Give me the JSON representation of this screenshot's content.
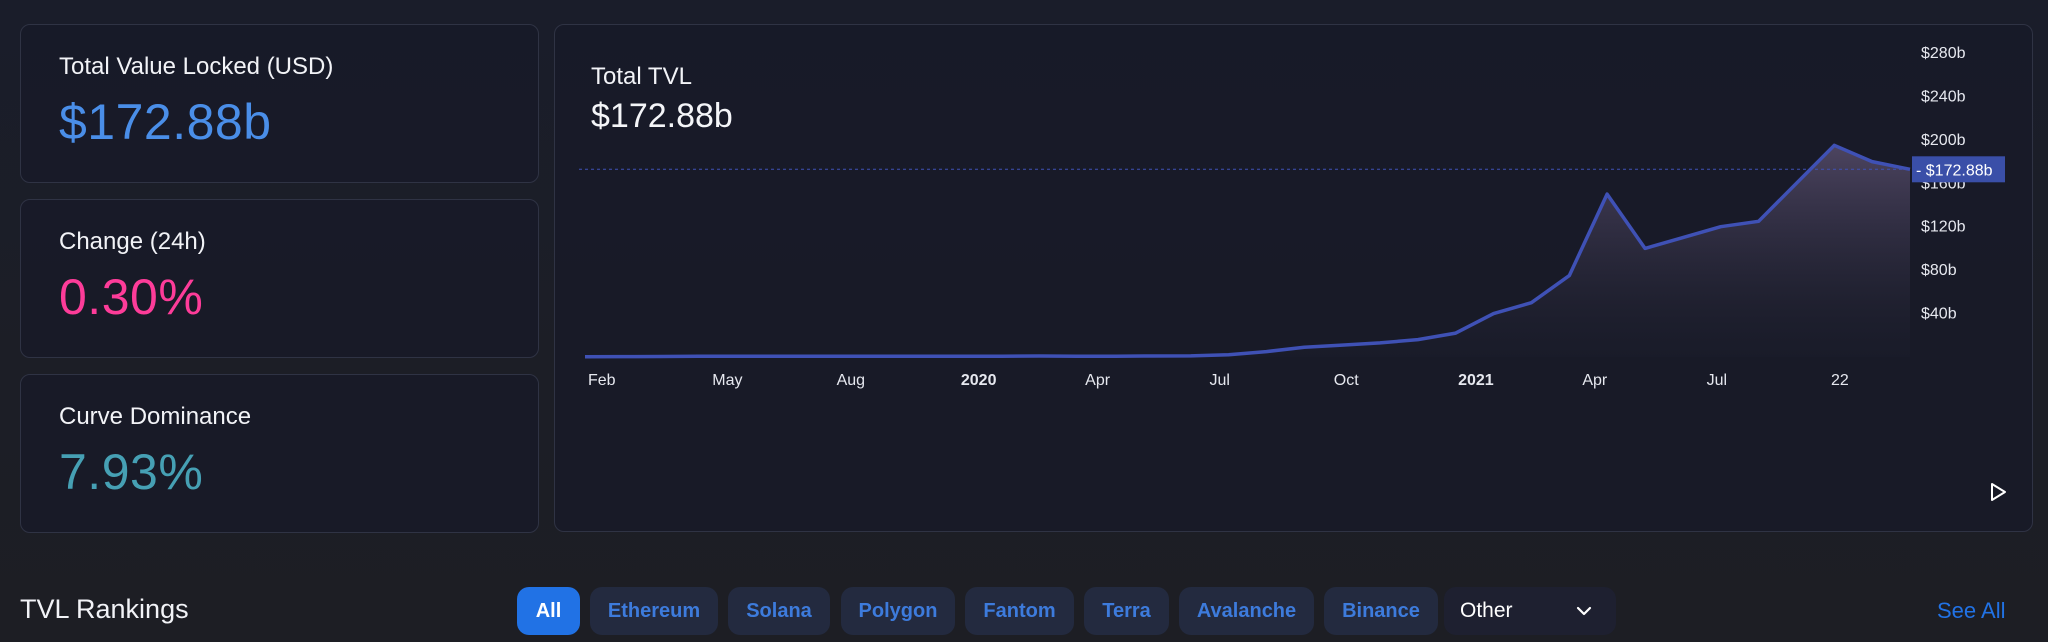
{
  "stats": [
    {
      "label": "Total Value Locked (USD)",
      "value": "$172.88b",
      "color": "#4a8ee8"
    },
    {
      "label": "Change (24h)",
      "value": "0.30%",
      "color": "#fd3c99"
    },
    {
      "label": "Curve Dominance",
      "value": "7.93%",
      "color": "#46a0b4"
    }
  ],
  "chart": {
    "title": "Total TVL",
    "value": "$172.88b",
    "current_label": "$172.88b"
  },
  "chart_data": {
    "type": "area",
    "title": "Total TVL",
    "xlabel": "",
    "ylabel": "",
    "ylim": [
      0,
      280
    ],
    "y_unit": "USD billions",
    "y_ticks": [
      "$40b",
      "$80b",
      "$120b",
      "$160b",
      "$200b",
      "$240b",
      "$280b"
    ],
    "x_ticks": [
      {
        "label": "Feb",
        "bold": false
      },
      {
        "label": "May",
        "bold": false
      },
      {
        "label": "Aug",
        "bold": false
      },
      {
        "label": "2020",
        "bold": true
      },
      {
        "label": "Apr",
        "bold": false
      },
      {
        "label": "Jul",
        "bold": false
      },
      {
        "label": "Oct",
        "bold": false
      },
      {
        "label": "2021",
        "bold": true
      },
      {
        "label": "Apr",
        "bold": false
      },
      {
        "label": "Jul",
        "bold": false
      },
      {
        "label": "22",
        "bold": false
      }
    ],
    "x": [
      "2019-02",
      "2019-03",
      "2019-04",
      "2019-05",
      "2019-06",
      "2019-07",
      "2019-08",
      "2019-09",
      "2019-10",
      "2019-11",
      "2019-12",
      "2020-01",
      "2020-02",
      "2020-03",
      "2020-04",
      "2020-05",
      "2020-06",
      "2020-07",
      "2020-08",
      "2020-09",
      "2020-10",
      "2020-11",
      "2020-12",
      "2021-01",
      "2021-02",
      "2021-03",
      "2021-04",
      "2021-05",
      "2021-06",
      "2021-07",
      "2021-08",
      "2021-09",
      "2021-10",
      "2021-11",
      "2021-12",
      "2022-01"
    ],
    "series": [
      {
        "values": [
          0.3,
          0.4,
          0.5,
          0.6,
          0.6,
          0.6,
          0.6,
          0.6,
          0.6,
          0.7,
          0.7,
          0.7,
          0.9,
          0.6,
          0.7,
          0.9,
          1.0,
          2.0,
          5.0,
          9.0,
          11.0,
          13.0,
          16.0,
          22.0,
          40.0,
          50.0,
          75.0,
          150.0,
          100.0,
          110.0,
          120.0,
          125.0,
          160.0,
          195.0,
          180.0,
          172.88
        ]
      }
    ],
    "current_value": 172.88,
    "colors": {
      "line": "#3f51b5",
      "fill_top": "#5a4f6e",
      "fill_bottom": "#1e2030",
      "marker_bg": "#3a4fa8"
    },
    "grid": false
  },
  "rankings": {
    "title": "TVL Rankings",
    "chains": [
      {
        "label": "All",
        "active": true
      },
      {
        "label": "Ethereum",
        "active": false
      },
      {
        "label": "Solana",
        "active": false
      },
      {
        "label": "Polygon",
        "active": false
      },
      {
        "label": "Fantom",
        "active": false
      },
      {
        "label": "Terra",
        "active": false
      },
      {
        "label": "Avalanche",
        "active": false
      },
      {
        "label": "Binance",
        "active": false
      }
    ],
    "other_label": "Other",
    "see_all": "See All"
  },
  "icons": {
    "play": "play-icon",
    "dropdown": "chevron-down-icon"
  }
}
